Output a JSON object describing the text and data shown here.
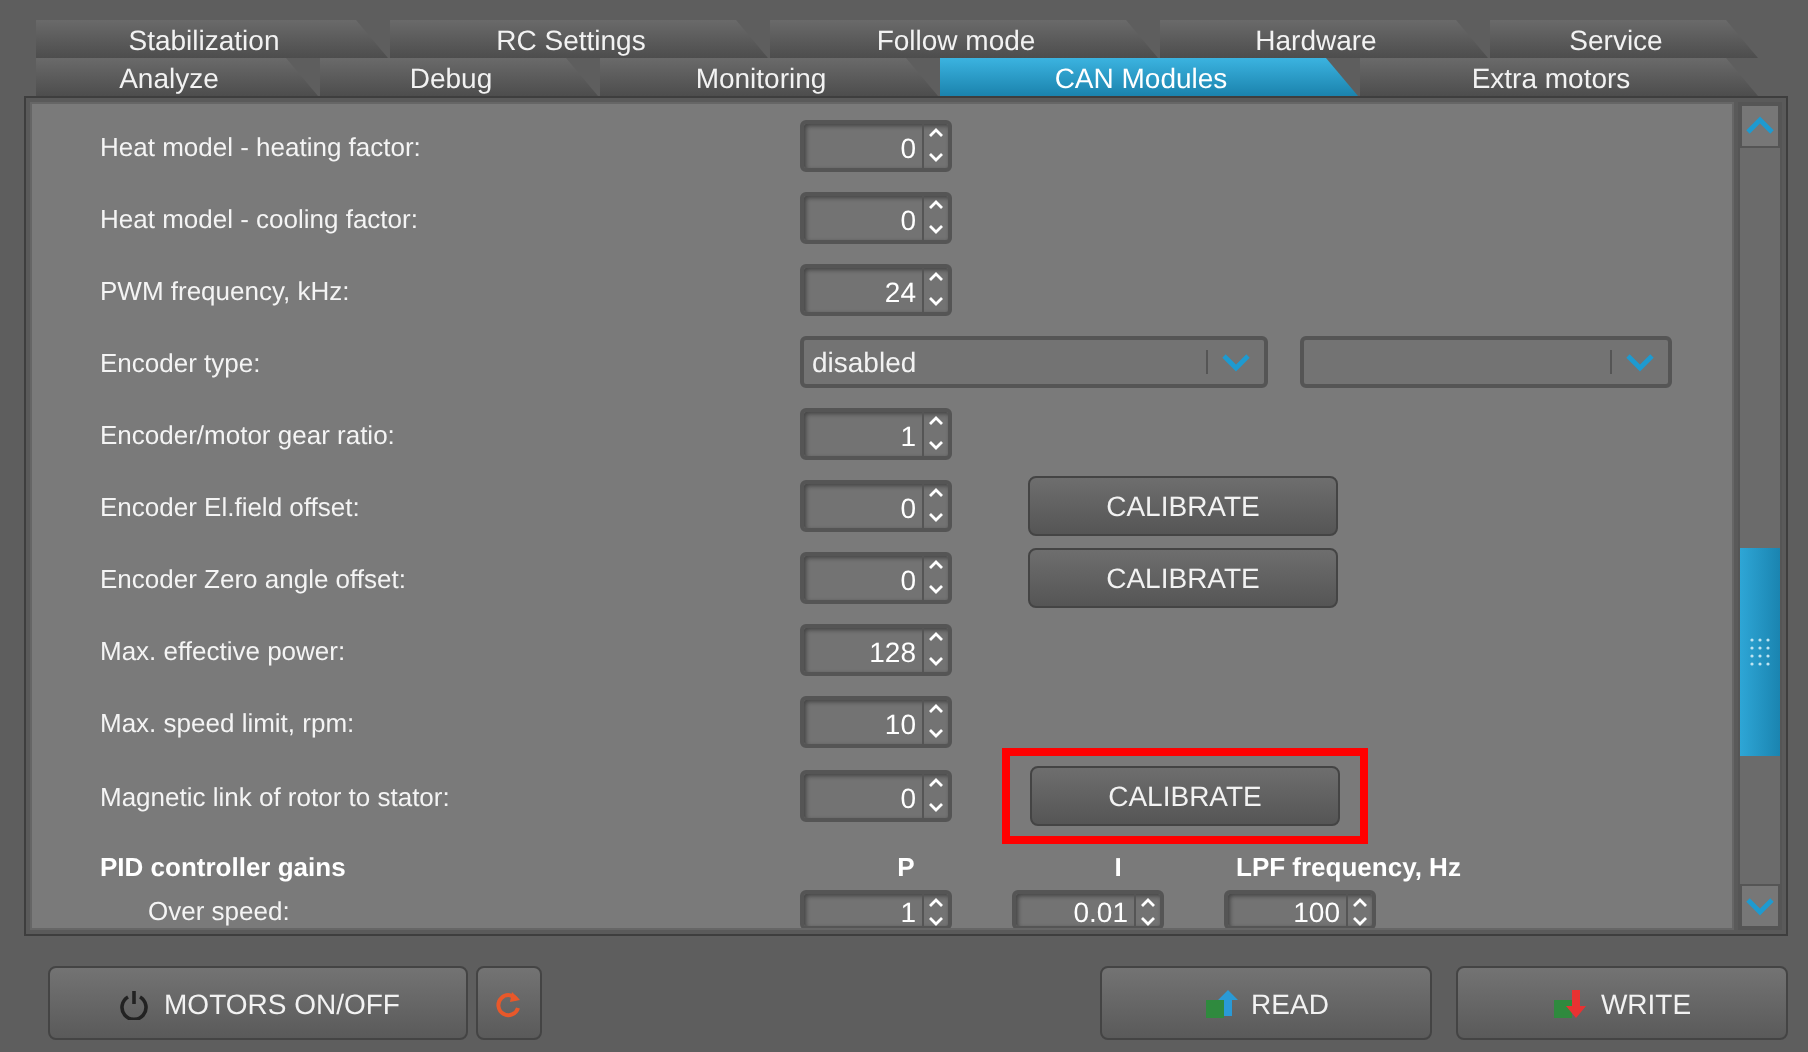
{
  "tabs": [
    [
      {
        "label": "Stabilization",
        "selected": false
      },
      {
        "label": "RC Settings",
        "selected": false
      },
      {
        "label": "Follow mode",
        "selected": false
      },
      {
        "label": "Hardware",
        "selected": false
      },
      {
        "label": "Service",
        "selected": false
      }
    ],
    [
      {
        "label": "Analyze",
        "selected": false
      },
      {
        "label": "Debug",
        "selected": false
      },
      {
        "label": "Monitoring",
        "selected": false
      },
      {
        "label": "CAN Modules",
        "selected": true
      },
      {
        "label": "Extra motors",
        "selected": false
      }
    ]
  ],
  "settings": [
    {
      "kind": "spin",
      "label": "Heat model - heating factor:",
      "value": "0"
    },
    {
      "kind": "spin",
      "label": "Heat model - cooling factor:",
      "value": "0"
    },
    {
      "kind": "spin",
      "label": "PWM frequency, kHz:",
      "value": "24"
    },
    {
      "kind": "select",
      "label": "Encoder type:",
      "selects": [
        {
          "value": "disabled"
        }
      ],
      "second_select": true
    },
    {
      "kind": "spin",
      "label": "Encoder/motor gear ratio:",
      "value": "1"
    },
    {
      "kind": "spin",
      "label": "Encoder El.field offset:",
      "value": "0",
      "button": {
        "label": "CALIBRATE",
        "highlighted": false
      }
    },
    {
      "kind": "spin",
      "label": "Encoder Zero angle offset:",
      "value": "0",
      "button": {
        "label": "CALIBRATE",
        "highlighted": false
      }
    },
    {
      "kind": "spin",
      "label": "Max. effective power:",
      "value": "128"
    },
    {
      "kind": "spin",
      "label": "Max. speed limit, rpm:",
      "value": "10"
    },
    {
      "kind": "spin",
      "label": "Magnetic link of rotor to stator:",
      "value": "0",
      "button": {
        "label": "CALIBRATE",
        "highlighted": true
      }
    }
  ],
  "pid": {
    "title": "PID controller gains",
    "columns": [
      "P",
      "I",
      "LPF frequency, Hz"
    ],
    "rows": [
      {
        "label": "Over speed:",
        "values": [
          "1",
          "0.01",
          "100"
        ]
      }
    ]
  },
  "buttons": [
    {
      "kind": "power",
      "label": "MOTORS ON/OFF"
    },
    {
      "kind": "refresh"
    },
    {
      "kind": "spacer"
    },
    {
      "kind": "read",
      "label": "READ"
    },
    {
      "kind": "write",
      "label": "WRITE"
    }
  ]
}
